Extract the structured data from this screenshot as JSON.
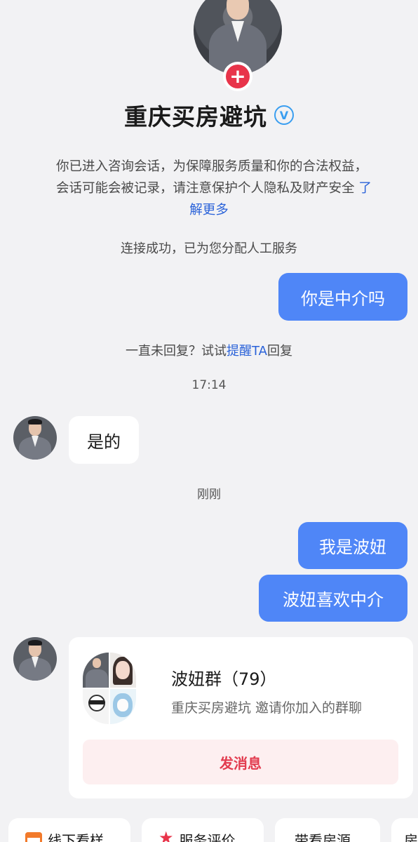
{
  "profile": {
    "name": "重庆买房避坑",
    "verified_mark": "V",
    "add_symbol": "+"
  },
  "notice": {
    "line1": "你已进入咨询会话，为保障服务质量和你的合法权益，",
    "line2_text": "会话可能会被记录，请注意保护个人隐私及财产安全",
    "line2_link": "了",
    "line3_link": "解更多"
  },
  "system": {
    "connected": "连接成功，已为您分配人工服务",
    "reminder_prefix": "一直未回复？试试",
    "reminder_link": "提醒TA",
    "reminder_suffix": "回复"
  },
  "messages": {
    "m1": "你是中介吗",
    "time1": "17:14",
    "m2": "是的",
    "time2": "刚刚",
    "m3": "我是波妞",
    "m4": "波妞喜欢中介"
  },
  "group_card": {
    "name": "波妞群（79）",
    "description": "重庆买房避坑 邀请你加入的群聊",
    "button": "发消息"
  },
  "quick_actions": [
    {
      "label": "线下看样",
      "icon": "calendar-icon"
    },
    {
      "label": "服务评价",
      "icon": "star-icon"
    },
    {
      "label": "带看房源",
      "icon": ""
    },
    {
      "label": "房",
      "icon": ""
    }
  ],
  "colors": {
    "accent_blue": "#4f86f7",
    "link_blue": "#2b63d9",
    "red": "#e8344a",
    "background": "#f2f2f4"
  }
}
